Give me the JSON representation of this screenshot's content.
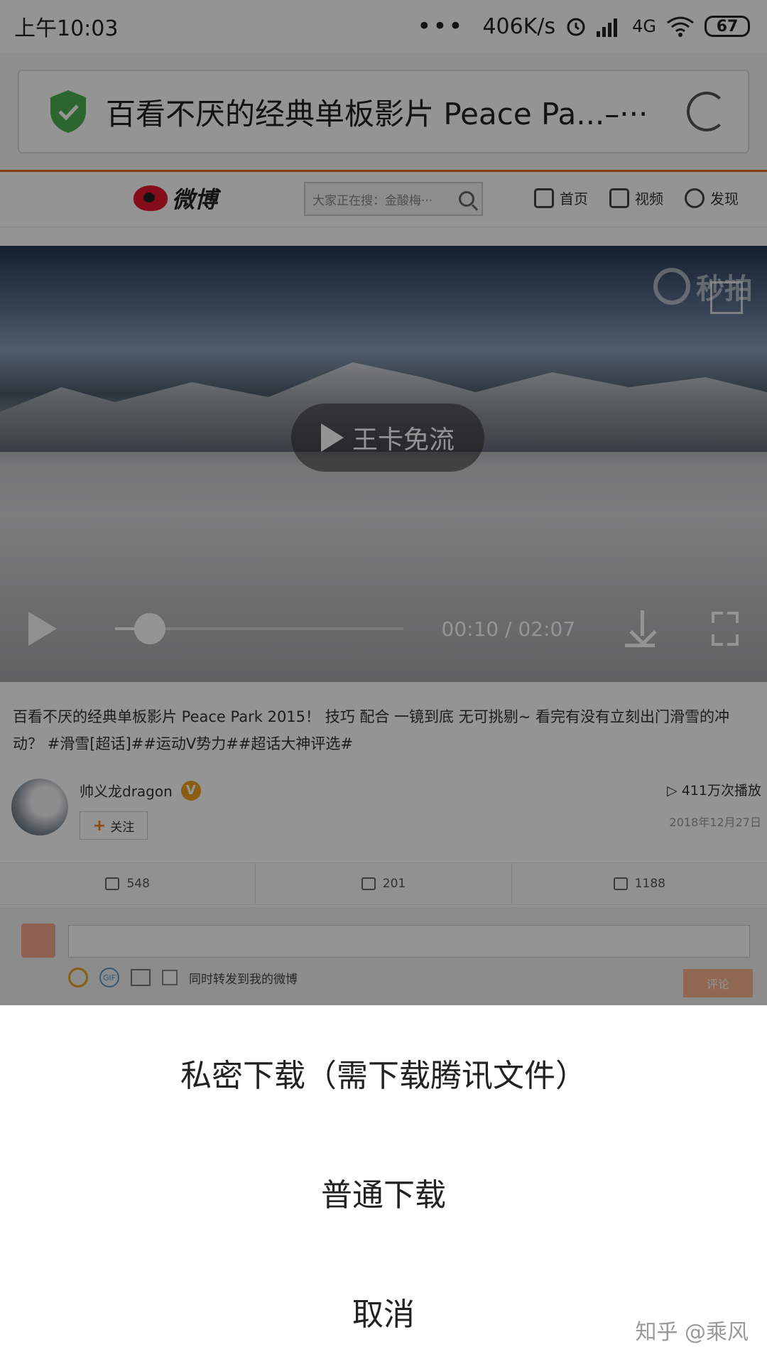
{
  "status_bar": {
    "time": "上午10:03",
    "dots": "•••",
    "network_speed": "406K/s",
    "network_type": "4G",
    "battery": "67"
  },
  "browser": {
    "page_title": "百看不厌的经典单板影片 Peace Pa...–···"
  },
  "weibo_nav": {
    "logo_text": "微博",
    "search_placeholder": "大家正在搜：金酸梅···",
    "links": [
      "首页",
      "视频",
      "发现"
    ]
  },
  "video": {
    "watermark": "秒拍",
    "overlay_label": "王卡免流",
    "current_time": "00:10",
    "duration": "02:07",
    "time_display": "00:10 / 02:07",
    "progress_fraction": 0.12
  },
  "post": {
    "description": "百看不厌的经典单板影片 Peace Park 2015！ 技巧 配合 一镜到底 无可挑剔~ 看完有没有立刻出门滑雪的冲动？ #滑雪[超话]##运动V势力##超话大神评选#",
    "author_name": "帅义龙dragon",
    "verified_badge": "V",
    "follow_label": "关注",
    "plays": "▷ 411万次播放",
    "date": "2018年12月27日"
  },
  "actions": {
    "repost_count": "548",
    "comment_count": "201",
    "like_count": "1188"
  },
  "comment_box": {
    "gif_label": "GIF",
    "forward_checkbox_label": "同时转发到我的微博",
    "submit_label": "评论"
  },
  "sheet": {
    "private_download": "私密下载（需下载腾讯文件）",
    "normal_download": "普通下载",
    "cancel": "取消"
  },
  "watermark_credit": "知乎 @乘风",
  "colors": {
    "weibo_red": "#e6162d",
    "accent_orange": "#e36b1e",
    "shield_green": "#4caf50",
    "badge_gold": "#f0a020"
  }
}
